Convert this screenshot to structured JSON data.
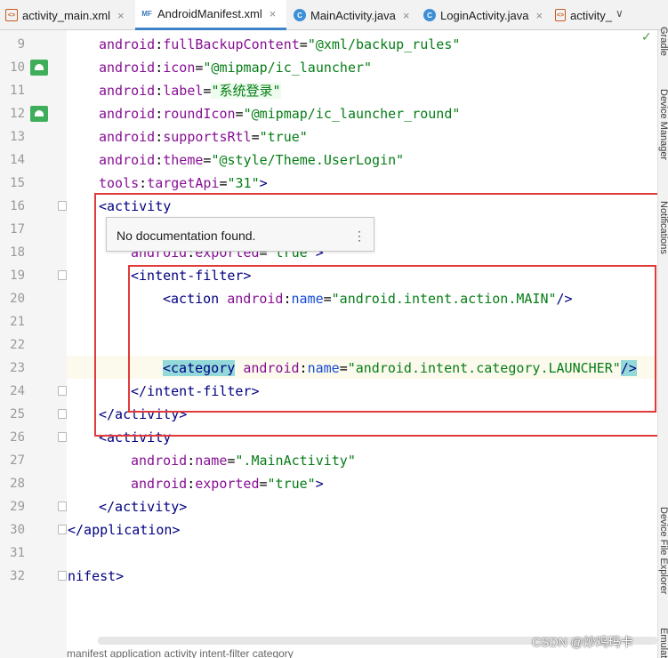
{
  "tabs": [
    {
      "label": "activity_main.xml",
      "icon": "xml-file-icon"
    },
    {
      "label": "AndroidManifest.xml",
      "icon": "manifest-file-icon"
    },
    {
      "label": "MainActivity.java",
      "icon": "java-class-icon"
    },
    {
      "label": "LoginActivity.java",
      "icon": "java-class-icon"
    },
    {
      "label": "activity_",
      "icon": "xml-file-icon"
    }
  ],
  "tab_menu": "∨",
  "lines": {
    "9": {
      "num": "9",
      "ns": "android",
      "attr": "fullBackupContent",
      "value": "\"@xml/backup_rules\""
    },
    "10": {
      "num": "10",
      "ns": "android",
      "attr": "icon",
      "value": "\"@mipmap/ic_launcher\""
    },
    "11": {
      "num": "11",
      "ns": "android",
      "attr": "label",
      "value": "\"系统登录\""
    },
    "12": {
      "num": "12",
      "ns": "android",
      "attr": "roundIcon",
      "value": "\"@mipmap/ic_launcher_round\""
    },
    "13": {
      "num": "13",
      "ns": "android",
      "attr": "supportsRtl",
      "value": "\"true\""
    },
    "14": {
      "num": "14",
      "ns": "android",
      "attr": "theme",
      "value": "\"@style/Theme.UserLogin\""
    },
    "15": {
      "num": "15",
      "ns": "tools",
      "attr": "targetApi",
      "value": "\"31\"",
      "tail": ">"
    },
    "16": {
      "num": "16",
      "text": "<activity"
    },
    "17": {
      "num": "17"
    },
    "18": {
      "num": "18",
      "ns": "android",
      "attr": "exported",
      "value": "\"true\"",
      "tail": ">"
    },
    "19": {
      "num": "19",
      "text": "<intent-filter>"
    },
    "20": {
      "num": "20",
      "open": "<action",
      "ns": "android",
      "attr": "name",
      "value": "\"android.intent.action.MAIN\"",
      "tail": "/>"
    },
    "21": {
      "num": "21"
    },
    "22": {
      "num": "22"
    },
    "23": {
      "num": "23",
      "open": "<category",
      "ns": "android",
      "attr": "name",
      "value": "\"android.intent.category.LAUNCHER\"",
      "tail": "/>"
    },
    "24": {
      "num": "24",
      "text": "</intent-filter>"
    },
    "25": {
      "num": "25",
      "text": "</activity>"
    },
    "26": {
      "num": "26",
      "text": "<activity"
    },
    "27": {
      "num": "27",
      "ns": "android",
      "attr": "name",
      "value": "\".MainActivity\""
    },
    "28": {
      "num": "28",
      "ns": "android",
      "attr": "exported",
      "value": "\"true\"",
      "tail": ">"
    },
    "29": {
      "num": "29",
      "text": "</activity>"
    },
    "30": {
      "num": "30",
      "text": "</application>"
    },
    "31": {
      "num": "31"
    },
    "32": {
      "num": "32",
      "text": "nifest>"
    }
  },
  "tooltip": {
    "text": "No documentation found.",
    "more": "⋮"
  },
  "side_panels": [
    "Gradle",
    "Device Manager",
    "Notifications",
    "Device File Explorer",
    "Emulator"
  ],
  "check_mark": "✓",
  "breadcrumb": "manifest  application  activity  intent-filter  category",
  "watermark": "CSDN @炒鸡玛卡"
}
